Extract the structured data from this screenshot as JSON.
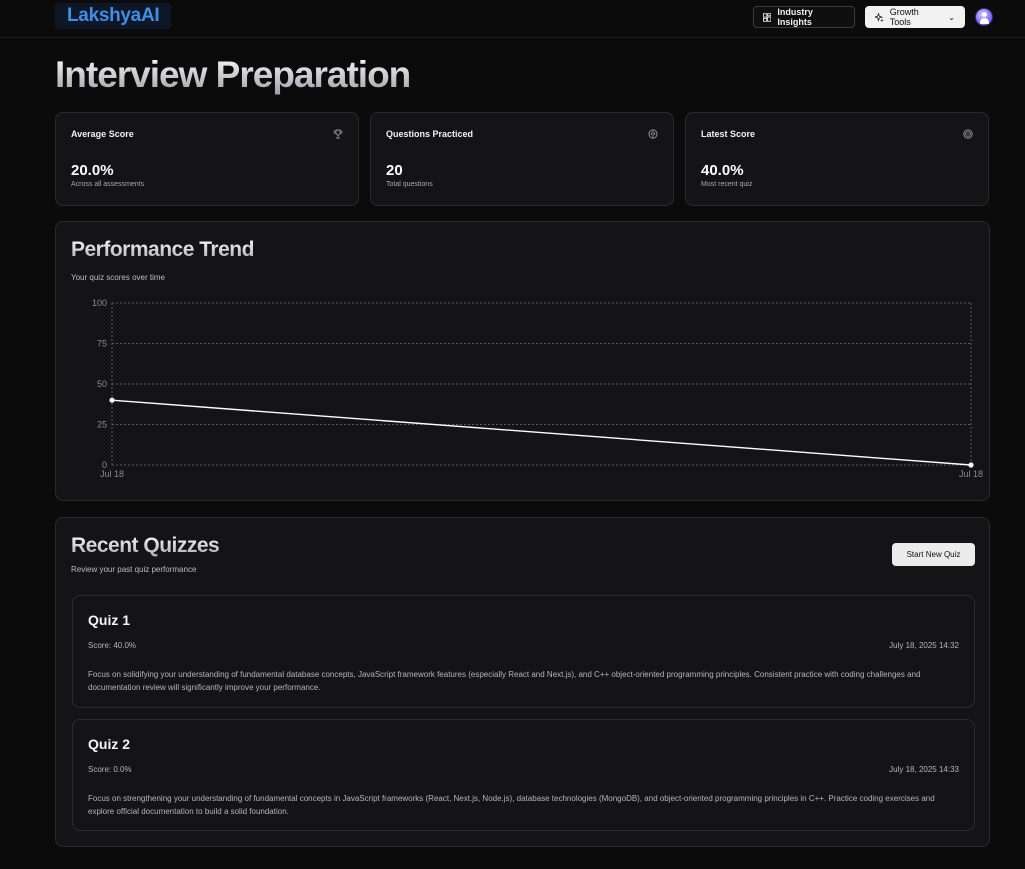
{
  "header": {
    "logo": "LakshyaAI",
    "insights_label": "Industry Insights",
    "growth_label": "Growth Tools"
  },
  "page": {
    "title": "Interview Preparation"
  },
  "stats": [
    {
      "label": "Average Score",
      "value": "20.0%",
      "sub": "Across all assessments",
      "icon": "trophy-icon"
    },
    {
      "label": "Questions Practiced",
      "value": "20",
      "sub": "Total questions",
      "icon": "brain-icon"
    },
    {
      "label": "Latest Score",
      "value": "40.0%",
      "sub": "Most recent quiz",
      "icon": "target-icon"
    }
  ],
  "performance": {
    "title": "Performance Trend",
    "subtitle": "Your quiz scores over time"
  },
  "chart_data": {
    "type": "line",
    "x": [
      "Jul 18",
      "Jul 18"
    ],
    "series": [
      {
        "values": [
          40,
          0
        ]
      }
    ],
    "yticks": [
      0,
      25,
      50,
      75,
      100
    ],
    "ylim": [
      0,
      100
    ],
    "grid": true,
    "colors": {
      "line": "#ffffff",
      "grid": "#5a5a60",
      "tick": "#8a8a90"
    }
  },
  "recent": {
    "title": "Recent Quizzes",
    "subtitle": "Review your past quiz performance",
    "start_label": "Start New Quiz",
    "quizzes": [
      {
        "title": "Quiz 1",
        "score": "Score: 40.0%",
        "date": "July 18, 2025 14:32",
        "text": "Focus on solidifying your understanding of fundamental database concepts, JavaScript framework features (especially React and Next.js), and C++ object-oriented programming principles. Consistent practice with coding challenges and documentation review will significantly improve your performance."
      },
      {
        "title": "Quiz 2",
        "score": "Score: 0.0%",
        "date": "July 18, 2025 14:33",
        "text": "Focus on strengthening your understanding of fundamental concepts in JavaScript frameworks (React, Next.js, Node.js), database technologies (MongoDB), and object-oriented programming principles in C++. Practice coding exercises and explore official documentation to build a solid foundation."
      }
    ]
  }
}
